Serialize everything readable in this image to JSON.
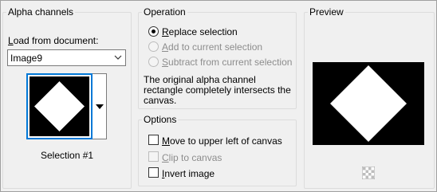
{
  "alpha_channels": {
    "title": "Alpha channels",
    "load_label": "Load from document:",
    "document_select": {
      "value": "Image9"
    },
    "thumbnail_icon": "diamond-selection-thumbnail",
    "dropdown_icon": "triangle-down-icon",
    "selection_caption": "Selection #1"
  },
  "operation": {
    "title": "Operation",
    "options": [
      {
        "label": "Replace selection",
        "accel": "R",
        "rest": "eplace selection",
        "selected": true,
        "enabled": true
      },
      {
        "label": "Add to current selection",
        "accel": "A",
        "rest": "dd to current selection",
        "selected": false,
        "enabled": false
      },
      {
        "label": "Subtract from current selection",
        "accel": "S",
        "rest": "ubtract from current selection",
        "selected": false,
        "enabled": false
      }
    ],
    "description_lines": [
      "The original alpha channel",
      "rectangle completely intersects the",
      "canvas."
    ]
  },
  "options": {
    "title": "Options",
    "items": [
      {
        "label": "Move to upper left of canvas",
        "accel": "M",
        "rest": "ove to upper left of canvas",
        "checked": false,
        "enabled": true
      },
      {
        "label": "Clip to canvas",
        "accel": "C",
        "rest": "lip to canvas",
        "checked": false,
        "enabled": false
      },
      {
        "label": "Invert image",
        "accel": "I",
        "rest": "nvert image",
        "checked": false,
        "enabled": true
      }
    ]
  },
  "preview": {
    "title": "Preview",
    "image_icon": "diamond-preview",
    "transparency_icon": "checkerboard-transparency-icon"
  },
  "colors": {
    "background": "#f0f0f0",
    "border": "#dcdcdc",
    "focus_blue": "#0078d7",
    "disabled_text": "#8d8d8d"
  }
}
